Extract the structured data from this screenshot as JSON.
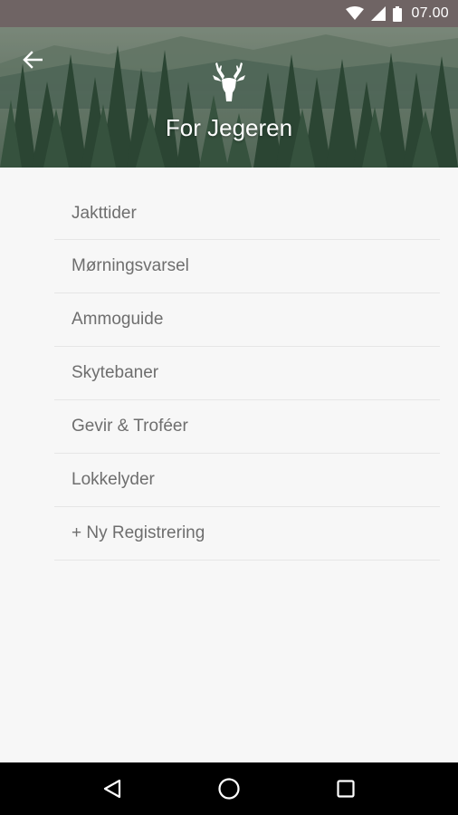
{
  "status_bar": {
    "time": "07.00",
    "icons": [
      "wifi-icon",
      "cellular-signal-icon",
      "battery-icon"
    ]
  },
  "header": {
    "title": "For Jegeren",
    "back_icon": "arrow-left-icon",
    "logo_icon": "deer-head-icon"
  },
  "menu": {
    "items": [
      {
        "label": "Jakttider"
      },
      {
        "label": "Mørningsvarsel"
      },
      {
        "label": "Ammoguide"
      },
      {
        "label": "Skytebaner"
      },
      {
        "label": "Gevir & Troféer"
      },
      {
        "label": "Lokkelyder"
      },
      {
        "label": "+ Ny Registrering"
      }
    ]
  },
  "nav_bar": {
    "icons": [
      "back-triangle-icon",
      "home-circle-icon",
      "recents-square-icon"
    ]
  },
  "colors": {
    "status_bar": "#6f6464",
    "header_forest": "#3f5a45",
    "background": "#f7f7f7",
    "menu_text": "#6e6e6e",
    "divider": "#e6e6e6",
    "nav_bar": "#000000"
  }
}
